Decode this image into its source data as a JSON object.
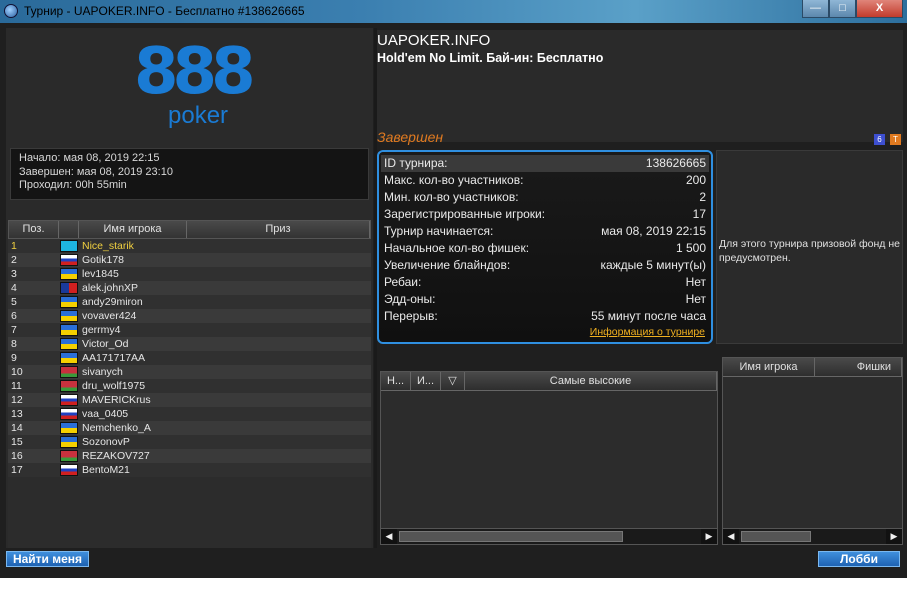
{
  "window": {
    "title": "Турнир - UAPOKER.INFO - Бесплатно #138626665",
    "controls": {
      "minimize": "—",
      "maximize": "□",
      "close": "X"
    }
  },
  "logo": {
    "number": "888",
    "word": "poker"
  },
  "times": {
    "start": "Начало: мая 08, 2019 22:15",
    "end": "Завершен: мая 08, 2019 23:10",
    "duration": "Проходил: 00h 55min"
  },
  "players_table": {
    "headers": {
      "pos": "Поз.",
      "name": "Имя игрока",
      "prize": "Приз"
    },
    "rows": [
      {
        "pos": "1",
        "name": "Nice_starik",
        "flag": "kz"
      },
      {
        "pos": "2",
        "name": "Gotik178",
        "flag": "ru"
      },
      {
        "pos": "3",
        "name": "lev1845",
        "flag": "ua"
      },
      {
        "pos": "4",
        "name": "alek.johnXP",
        "flag": "do"
      },
      {
        "pos": "5",
        "name": "andy29miron",
        "flag": "ua"
      },
      {
        "pos": "6",
        "name": "vovaver424",
        "flag": "ua"
      },
      {
        "pos": "7",
        "name": "gerrmy4",
        "flag": "ua"
      },
      {
        "pos": "8",
        "name": "Victor_Od",
        "flag": "ua"
      },
      {
        "pos": "9",
        "name": "AA171717AA",
        "flag": "ua"
      },
      {
        "pos": "10",
        "name": "sivanych",
        "flag": "by"
      },
      {
        "pos": "11",
        "name": "dru_wolf1975",
        "flag": "by"
      },
      {
        "pos": "12",
        "name": "MAVERICKrus",
        "flag": "ru"
      },
      {
        "pos": "13",
        "name": "vaa_0405",
        "flag": "ru"
      },
      {
        "pos": "14",
        "name": "Nemchenko_A",
        "flag": "ua"
      },
      {
        "pos": "15",
        "name": "SozonovP",
        "flag": "ua"
      },
      {
        "pos": "16",
        "name": "REZAKOV727",
        "flag": "by"
      },
      {
        "pos": "17",
        "name": "BentoM21",
        "flag": "ru"
      }
    ]
  },
  "tournament": {
    "name": "UAPOKER.INFO",
    "subtitle": "Hold'em No Limit. Бай-ин: Бесплатно",
    "status": "Завершен",
    "badges": [
      "6",
      "T"
    ]
  },
  "details": [
    {
      "label": "ID турнира:",
      "value": "138626665"
    },
    {
      "label": "Макс. кол-во участников:",
      "value": "200"
    },
    {
      "label": "Мин. кол-во участников:",
      "value": "2"
    },
    {
      "label": "Зарегистрированные игроки:",
      "value": "17"
    },
    {
      "label": "Турнир начинается:",
      "value": "мая 08, 2019 22:15"
    },
    {
      "label": "Начальное кол-во фишек:",
      "value": "1 500"
    },
    {
      "label": "Увеличение блайндов:",
      "value": "каждые 5 минут(ы)"
    },
    {
      "label": "Ребаи:",
      "value": "Нет"
    },
    {
      "label": "Эдд-оны:",
      "value": "Нет"
    },
    {
      "label": "Перерыв:",
      "value": "55 минут после часа"
    }
  ],
  "info_link": "Информация о турнире",
  "prize_text": "Для этого турнира призовой фонд не предусмотрен.",
  "hands_table": {
    "headers": [
      "Н...",
      "И...",
      "Самые высокие"
    ]
  },
  "chips_table": {
    "headers": [
      "Имя игрока",
      "Фишки"
    ]
  },
  "buttons": {
    "find_me": "Найти меня",
    "lobby": "Лобби"
  },
  "colors": {
    "accent": "#2f8fe0",
    "status": "#e07a20",
    "highlight": "#f0d040",
    "brand": "#1a7bd4"
  }
}
